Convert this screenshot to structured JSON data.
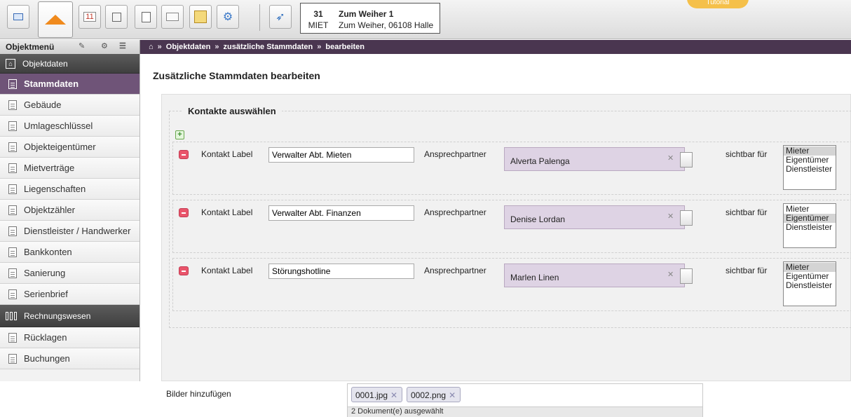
{
  "toolbar": {
    "tutorial": "Tutorial",
    "object": {
      "number": "31",
      "type": "MIET",
      "name": "Zum Weiher 1",
      "address": "Zum Weiher, 06108 Halle"
    }
  },
  "menu": {
    "label": "Objektmenü"
  },
  "breadcrumb": [
    "Objektdaten",
    "zusätzliche Stammdaten",
    "bearbeiten"
  ],
  "sidebar": {
    "section1": "Objektdaten",
    "items": [
      "Stammdaten",
      "Gebäude",
      "Umlageschlüssel",
      "Objekteigentümer",
      "Mietverträge",
      "Liegenschaften",
      "Objektzähler",
      "Dienstleister / Handwerker",
      "Bankkonten",
      "Sanierung",
      "Serienbrief"
    ],
    "section2": "Rechnungswesen",
    "items2": [
      "Rücklagen",
      "Buchungen"
    ]
  },
  "main": {
    "title": "Zusätzliche Stammdaten bearbeiten",
    "legend": "Kontakte auswählen",
    "label_contact": "Kontakt Label",
    "label_partner": "Ansprechpartner",
    "label_visible": "sichtbar für",
    "options": [
      "Mieter",
      "Eigentümer",
      "Dienstleister"
    ],
    "contacts": [
      {
        "label": "Verwalter Abt. Mieten",
        "partner": "Alverta Palenga",
        "selected": "Mieter"
      },
      {
        "label": "Verwalter Abt. Finanzen",
        "partner": "Denise Lordan",
        "selected": "Eigentümer"
      },
      {
        "label": "Störungshotline",
        "partner": "Marlen Linen",
        "selected": "Mieter"
      }
    ],
    "images_label": "Bilder hinzufügen",
    "images": [
      "0001.jpg",
      "0002.png"
    ],
    "images_status": "2 Dokument(e) ausgewählt"
  }
}
